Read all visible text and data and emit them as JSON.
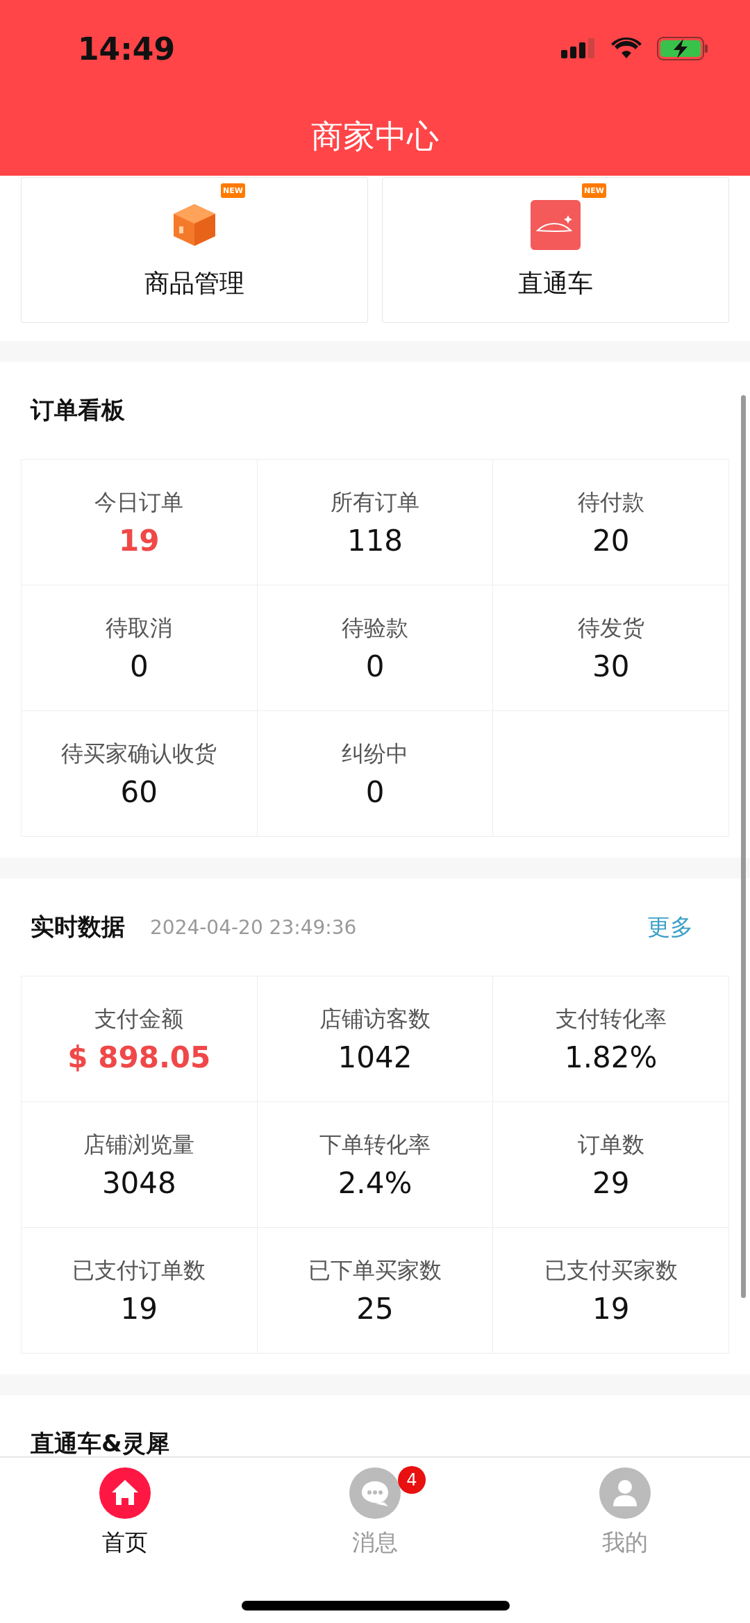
{
  "status_bar": {
    "time": "14:49"
  },
  "header": {
    "title": "商家中心"
  },
  "shortcuts": [
    {
      "label": "商品管理",
      "badge": "NEW",
      "kind": "box"
    },
    {
      "label": "直通车",
      "badge": "NEW",
      "kind": "car"
    }
  ],
  "order_board": {
    "title": "订单看板",
    "cells": [
      {
        "label": "今日订单",
        "value": "19",
        "highlight": true
      },
      {
        "label": "所有订单",
        "value": "118",
        "highlight": false
      },
      {
        "label": "待付款",
        "value": "20",
        "highlight": false
      },
      {
        "label": "待取消",
        "value": "0",
        "highlight": false
      },
      {
        "label": "待验款",
        "value": "0",
        "highlight": false
      },
      {
        "label": "待发货",
        "value": "30",
        "highlight": false
      },
      {
        "label": "待买家确认收货",
        "value": "60",
        "highlight": false
      },
      {
        "label": "纠纷中",
        "value": "0",
        "highlight": false
      }
    ]
  },
  "realtime": {
    "title": "实时数据",
    "timestamp": "2024-04-20 23:49:36",
    "more": "更多",
    "cells": [
      {
        "label": "支付金额",
        "value": "$ 898.05",
        "highlight": true
      },
      {
        "label": "店铺访客数",
        "value": "1042",
        "highlight": false
      },
      {
        "label": "支付转化率",
        "value": "1.82%",
        "highlight": false
      },
      {
        "label": "店铺浏览量",
        "value": "3048",
        "highlight": false
      },
      {
        "label": "下单转化率",
        "value": "2.4%",
        "highlight": false
      },
      {
        "label": "订单数",
        "value": "29",
        "highlight": false
      },
      {
        "label": "已支付订单数",
        "value": "19",
        "highlight": false
      },
      {
        "label": "已下单买家数",
        "value": "25",
        "highlight": false
      },
      {
        "label": "已支付买家数",
        "value": "19",
        "highlight": false
      }
    ]
  },
  "next_section": {
    "title": "直通车&灵犀"
  },
  "tabs": [
    {
      "label": "首页",
      "kind": "home",
      "selected": true
    },
    {
      "label": "消息",
      "kind": "message",
      "selected": false,
      "badge": "4"
    },
    {
      "label": "我的",
      "kind": "profile",
      "selected": false
    }
  ]
}
